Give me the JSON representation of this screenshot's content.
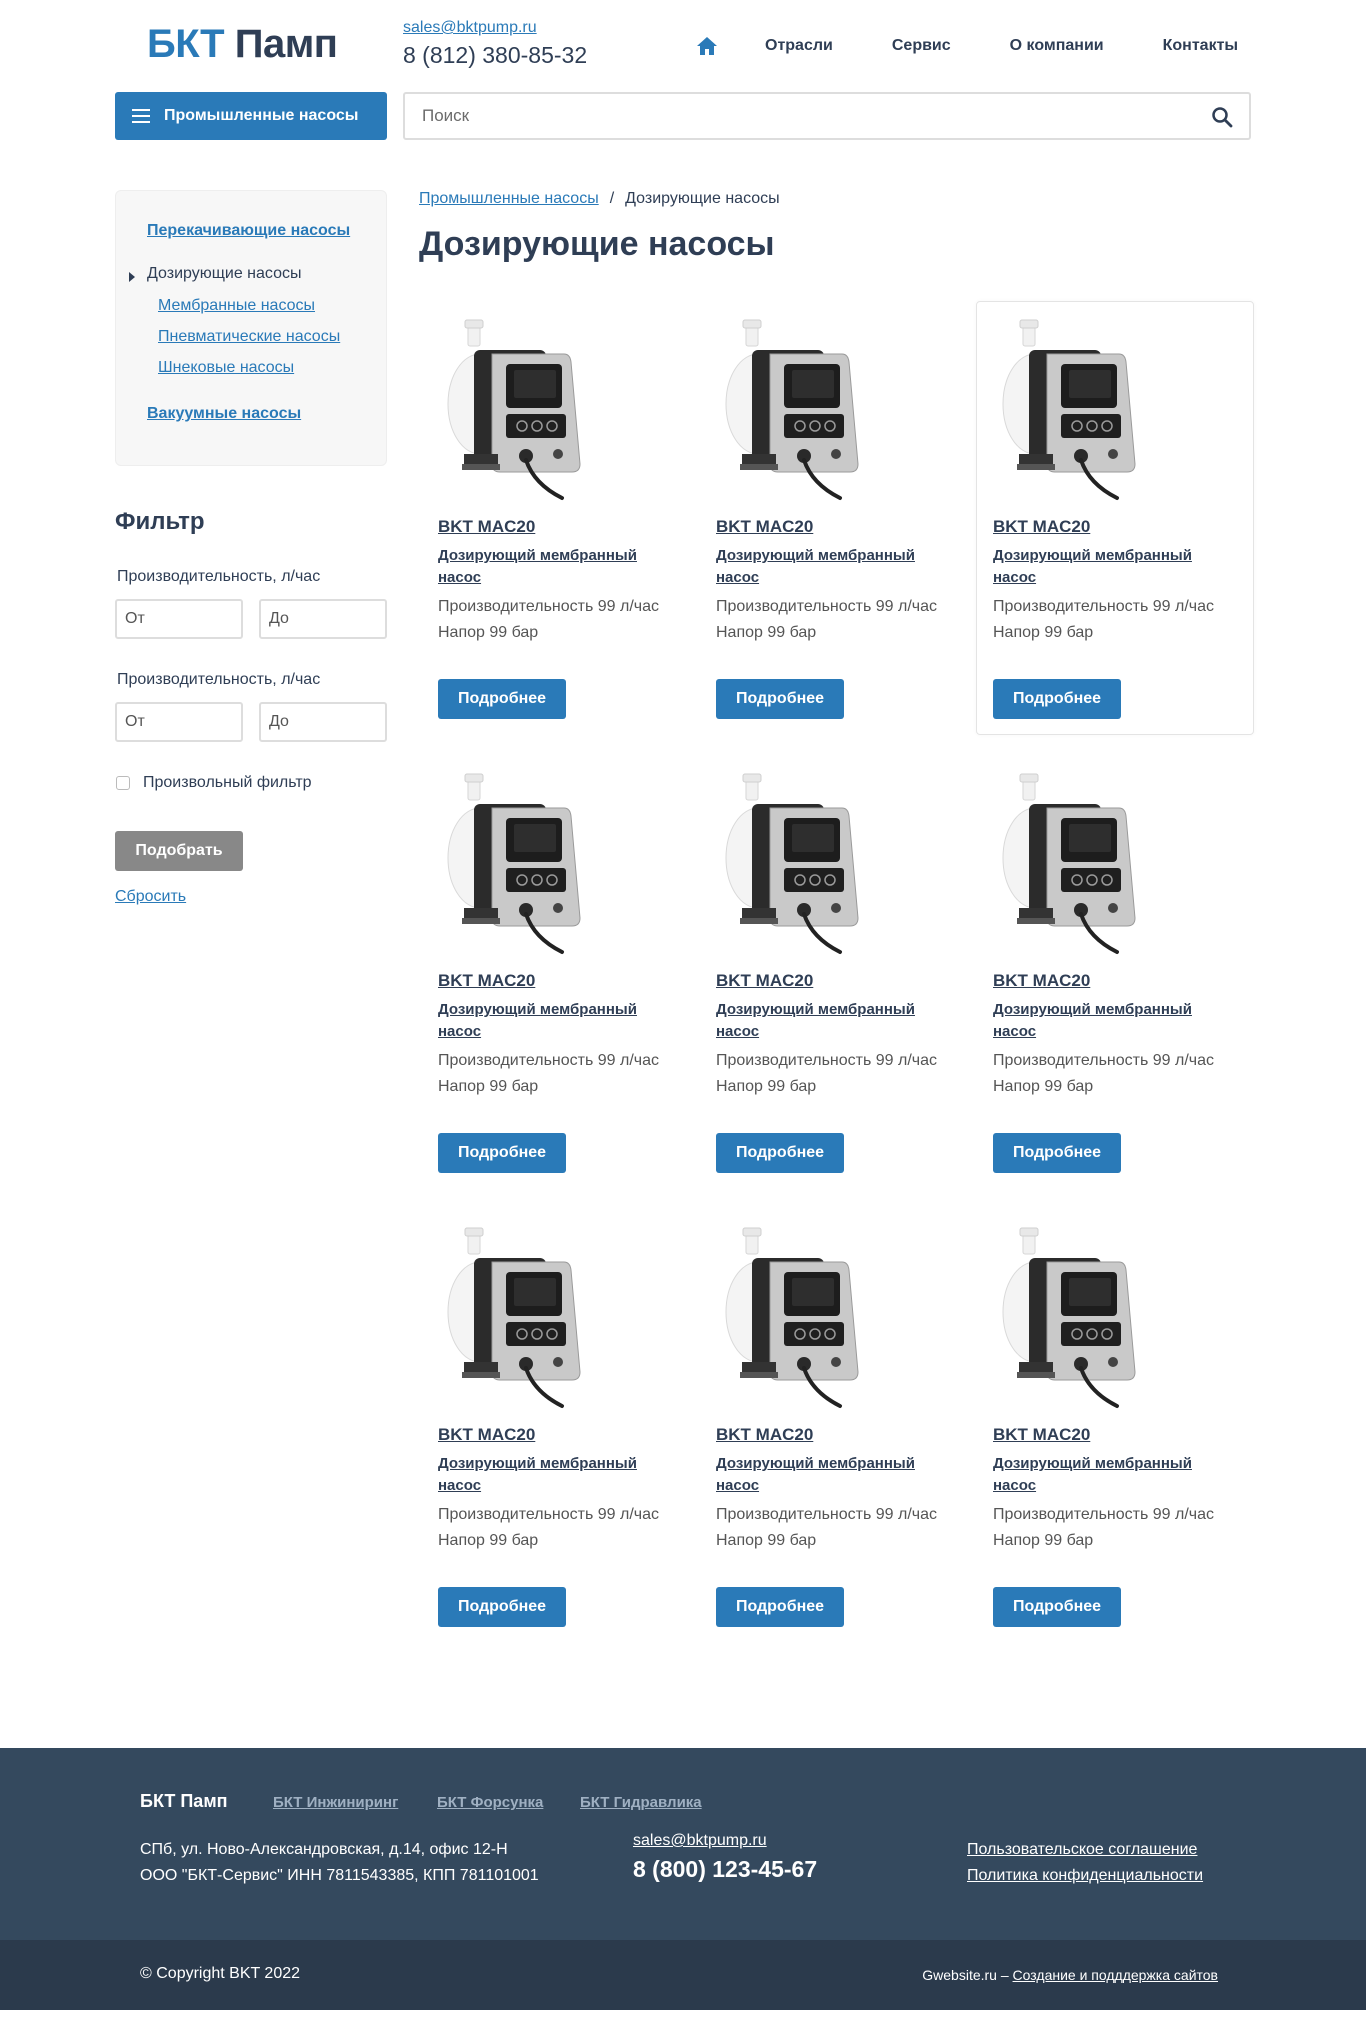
{
  "header": {
    "logo_part1": "БКТ",
    "logo_part2": "Памп",
    "email": "sales@bktpump.ru",
    "phone": "8 (812) 380-85-32",
    "nav": [
      "Отрасли",
      "Сервис",
      "О компании",
      "Контакты"
    ],
    "catalog_button": "Промышленные насосы",
    "search_placeholder": "Поиск"
  },
  "sidebar": {
    "menu": {
      "item1": "Перекачивающие насосы",
      "active": "Дозирующие насосы",
      "sub1": "Мембранные насосы",
      "sub2": "Пневматические насосы",
      "sub3": "Шнековые насосы",
      "item_last": "Вакуумные насосы"
    },
    "filter": {
      "title": "Фильтр",
      "group1_label": "Производительность, л/час",
      "group2_label": "Производительность, л/час",
      "from_placeholder": "От",
      "to_placeholder": "До",
      "checkbox_label": "Произвольный фильтр",
      "apply_button": "Подобрать",
      "reset_link": "Сбросить"
    }
  },
  "breadcrumb": {
    "parent": "Промышленные насосы",
    "separator": "/",
    "current": "Дозирующие насосы"
  },
  "page_title": "Дозирующие насосы",
  "products": [
    {
      "name": "BKT MAC20",
      "desc": "Дозирующий мембранный насос",
      "spec1": "Производительность 99 л/час",
      "spec2": "Напор 99 бар",
      "button": "Подробнее"
    },
    {
      "name": "BKT MAC20",
      "desc": "Дозирующий мембранный насос",
      "spec1": "Производительность 99 л/час",
      "spec2": "Напор 99 бар",
      "button": "Подробнее"
    },
    {
      "name": "BKT MAC20",
      "desc": "Дозирующий мембранный насос",
      "spec1": "Производительность 99 л/час",
      "spec2": "Напор 99 бар",
      "button": "Подробнее"
    },
    {
      "name": "BKT MAC20",
      "desc": "Дозирующий мембранный насос",
      "spec1": "Производительность 99 л/час",
      "spec2": "Напор 99 бар",
      "button": "Подробнее"
    },
    {
      "name": "BKT MAC20",
      "desc": "Дозирующий мембранный насос",
      "spec1": "Производительность 99 л/час",
      "spec2": "Напор 99 бар",
      "button": "Подробнее"
    },
    {
      "name": "BKT MAC20",
      "desc": "Дозирующий мембранный насос",
      "spec1": "Производительность 99 л/час",
      "spec2": "Напор 99 бар",
      "button": "Подробнее"
    },
    {
      "name": "BKT MAC20",
      "desc": "Дозирующий мембранный насос",
      "spec1": "Производительность 99 л/час",
      "spec2": "Напор 99 бар",
      "button": "Подробнее"
    },
    {
      "name": "BKT MAC20",
      "desc": "Дозирующий мембранный насос",
      "spec1": "Производительность 99 л/час",
      "spec2": "Напор 99 бар",
      "button": "Подробнее"
    },
    {
      "name": "BKT MAC20",
      "desc": "Дозирующий мембранный насос",
      "spec1": "Производительность 99 л/час",
      "spec2": "Напор 99 бар",
      "button": "Подробнее"
    }
  ],
  "footer": {
    "brand": "БКТ Памп",
    "links": [
      "БКТ Инжиниринг",
      "БКТ Форсунка",
      "БКТ Гидравлика"
    ],
    "address": "СПб, ул. Ново-Александровская, д.14, офис 12-Н",
    "company": "ООО \"БКТ-Сервис\" ИНН 7811543385, КПП 781101001",
    "email": "sales@bktpump.ru",
    "phone": "8 (800) 123-45-67",
    "legal1": "Пользовательское соглашение",
    "legal2": "Политика конфиденциальности",
    "copyright": "© Copyright BKT 2022",
    "dev_site": "Gwebsite.ru",
    "dev_sep": " – ",
    "dev_link": "Создание и подддержка сайтов"
  },
  "colors": {
    "accent": "#2a7ab8",
    "dark_text": "#2f3e55",
    "footer_bg": "#34495e",
    "bottom_bar_bg": "#2b3a4c",
    "filter_button_bg": "#888888"
  },
  "icons": [
    "home-icon",
    "menu-icon",
    "search-icon",
    "pump-image",
    "submenu-arrow-icon"
  ]
}
